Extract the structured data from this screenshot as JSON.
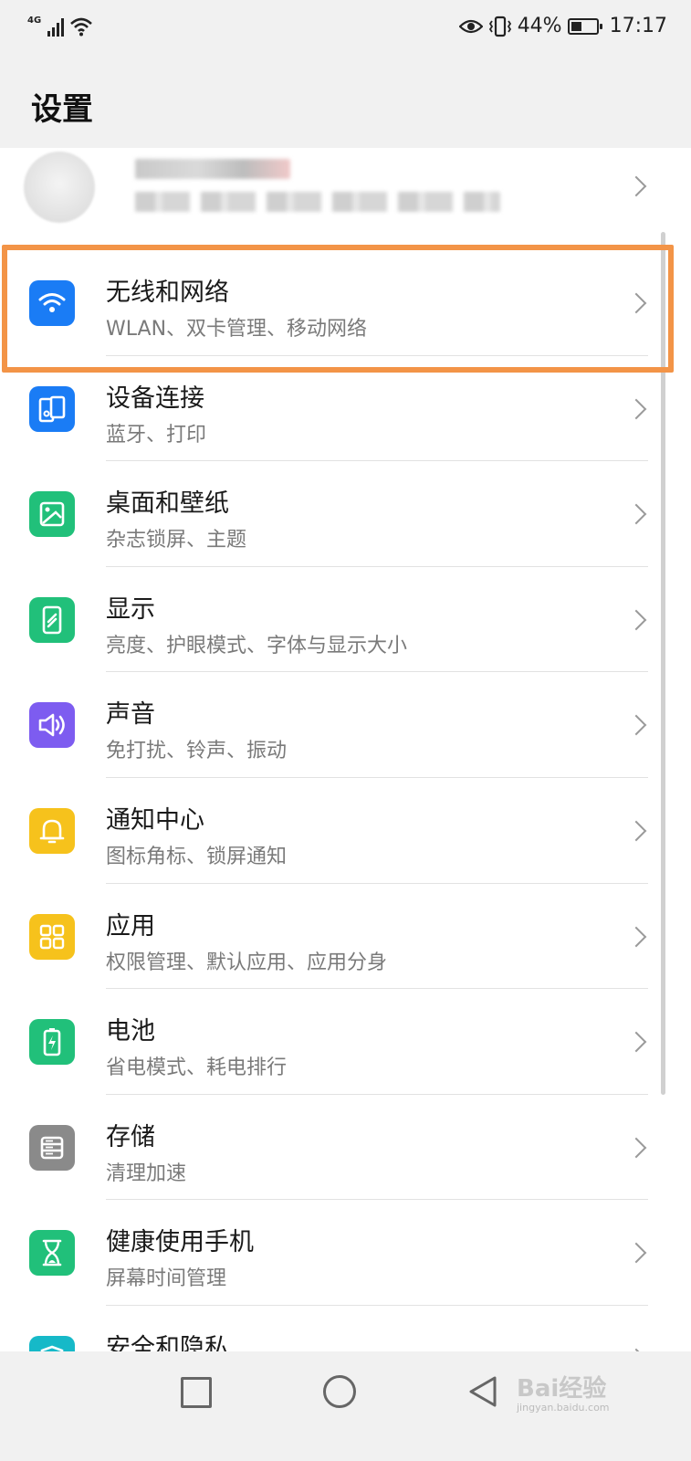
{
  "status_bar": {
    "network_type": "4G",
    "battery_percent": "44%",
    "battery_level": 0.44,
    "time": "17:17"
  },
  "header": {
    "title": "设置"
  },
  "menu": {
    "items": [
      {
        "title": "无线和网络",
        "subtitle": "WLAN、双卡管理、移动网络",
        "icon": "wifi-icon",
        "color": "#1a7cf5"
      },
      {
        "title": "设备连接",
        "subtitle": "蓝牙、打印",
        "icon": "device-connection-icon",
        "color": "#1a7cf5"
      },
      {
        "title": "桌面和壁纸",
        "subtitle": "杂志锁屏、主题",
        "icon": "wallpaper-icon",
        "color": "#21c07a"
      },
      {
        "title": "显示",
        "subtitle": "亮度、护眼模式、字体与显示大小",
        "icon": "display-icon",
        "color": "#21c07a"
      },
      {
        "title": "声音",
        "subtitle": "免打扰、铃声、振动",
        "icon": "speaker-icon",
        "color": "#7d5cf0"
      },
      {
        "title": "通知中心",
        "subtitle": "图标角标、锁屏通知",
        "icon": "bell-icon",
        "color": "#f6c21c"
      },
      {
        "title": "应用",
        "subtitle": "权限管理、默认应用、应用分身",
        "icon": "apps-grid-icon",
        "color": "#f6c21c"
      },
      {
        "title": "电池",
        "subtitle": "省电模式、耗电排行",
        "icon": "battery-icon",
        "color": "#21c07a"
      },
      {
        "title": "存储",
        "subtitle": "清理加速",
        "icon": "storage-icon",
        "color": "#8a8a8a"
      },
      {
        "title": "健康使用手机",
        "subtitle": "屏幕时间管理",
        "icon": "hourglass-icon",
        "color": "#21c07a"
      },
      {
        "title": "安全和隐私",
        "subtitle": "",
        "icon": "shield-icon",
        "color": "#16b9c8"
      }
    ]
  },
  "highlight_color": "#f39447",
  "watermark": {
    "text": "Bai经验",
    "sub": "jingyan.baidu.com"
  }
}
